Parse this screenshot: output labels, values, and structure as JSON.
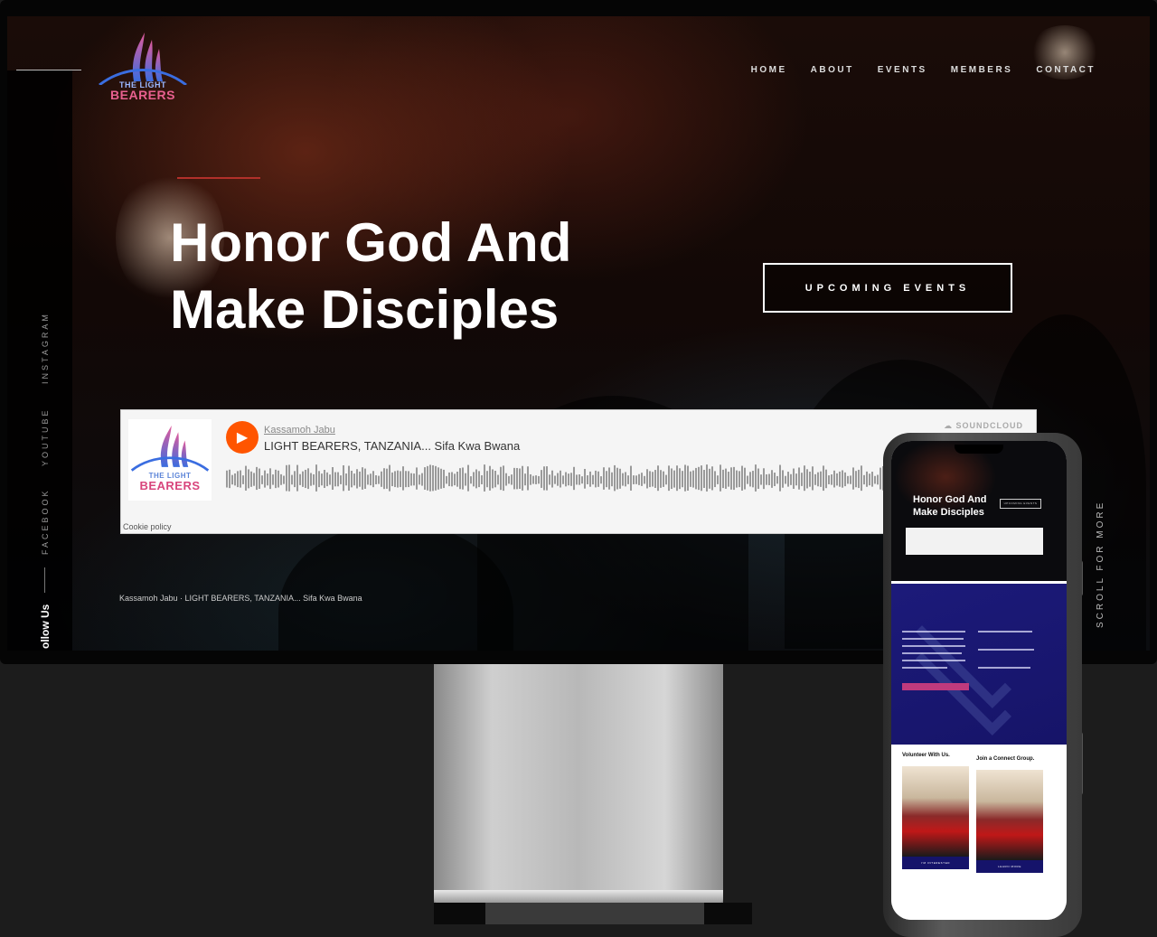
{
  "brand": {
    "line1": "THE LIGHT",
    "line2": "BEARERS"
  },
  "nav": [
    {
      "label": "HOME"
    },
    {
      "label": "ABOUT"
    },
    {
      "label": "EVENTS"
    },
    {
      "label": "MEMBERS"
    },
    {
      "label": "CONTACT"
    }
  ],
  "hero": {
    "title_line1": "Honor God And",
    "title_line2": "Make Disciples",
    "cta": "UPCOMING EVENTS"
  },
  "social": {
    "instagram": "INSTAGRAM",
    "youtube": "YOUTUBE",
    "facebook": "FACEBOOK",
    "follow": "ollow Us"
  },
  "scroll_label": "SCROLL FOR MORE",
  "soundcloud": {
    "user": "Kassamoh Jabu",
    "track": "LIGHT BEARERS, TANZANIA... Sifa Kwa Bwana",
    "brand": "SOUNDCLOUD",
    "cookie": "Cookie policy"
  },
  "now_playing": "Kassamoh Jabu · LIGHT BEARERS, TANZANIA... Sifa Kwa Bwana",
  "phone": {
    "hero_title_line1": "Honor God And",
    "hero_title_line2": "Make Disciples",
    "hero_button": "UPCOMING EVENTS",
    "volunteer_heading": "Volunteer With Us.",
    "connect_heading": "Join a Connect Group.",
    "volunteer_button": "I'M INTERESTED",
    "connect_button": "LEARN MORE"
  },
  "colors": {
    "accent_red": "#b1302a",
    "soundcloud_orange": "#ff5500",
    "brand_pink": "#e8608f",
    "phone_blue": "#1c1a7a"
  }
}
